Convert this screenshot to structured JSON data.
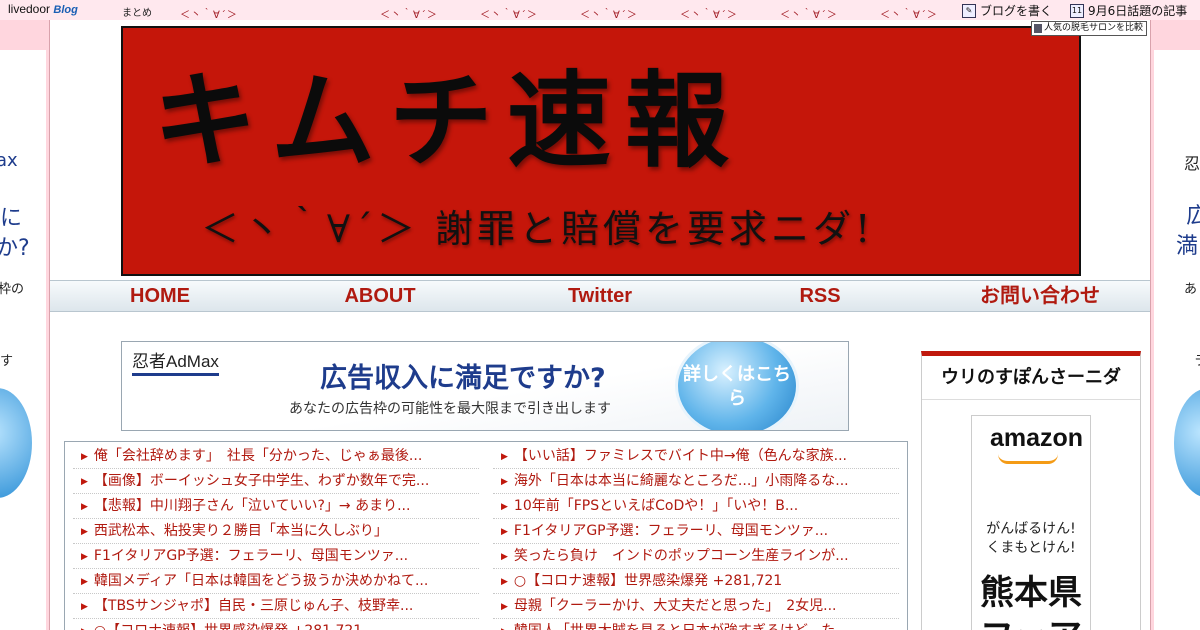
{
  "topbar": {
    "logo_text": "livedoor",
    "logo_blog": "Blog",
    "matome": "まとめ",
    "face": "＜丶｀∀´＞",
    "write_blog": "ブログを書く",
    "topic_article": "9月6日話題の記事",
    "calendar_day": "11"
  },
  "tooltip": "人気の脱毛サロンを比較",
  "side_ad_left": {
    "t1": "ax",
    "t2": "に",
    "t3": "か?",
    "s1": "枠の",
    "s2": "す"
  },
  "side_ad_right": {
    "t0": "忍",
    "t1": "広",
    "t2": "満",
    "s1": "あ",
    "s2": "ラ"
  },
  "header": {
    "title": "キムチ速報",
    "subtitle": "＜丶｀∀´＞ 謝罪と賠償を要求ニダ!"
  },
  "nav": {
    "items": [
      "HOME",
      "ABOUT",
      "Twitter",
      "RSS",
      "お問い合わせ"
    ]
  },
  "ad": {
    "brand": "忍者AdMax",
    "headline": "広告収入に満足ですか?",
    "sub": "あなたの広告枠の可能性を最大限まで引き出します",
    "button": "詳しくはこちら"
  },
  "headlines": {
    "left": [
      "俺「会社辞めます」　社長「分かった、じゃぁ最後...",
      "【画像】ボーイッシュ女子中学生、わずか数年で完...",
      "【悲報】中川翔子さん「泣いていい?」→ あまり...",
      "西武松本、粘投実り２勝目「本当に久しぶり」",
      "F1イタリアGP予選：フェラーリ、母国モンツァ...",
      "韓国メディア「日本は韓国をどう扱うか決めかねて...",
      "【TBSサンジャポ】自民・三原じゅん子、枝野幸...",
      "○【コロナ速報】世界感染爆発 +281,721"
    ],
    "right": [
      "【いい話】ファミレスでバイト中→俺（色んな家族...",
      "海外「日本は本当に綺麗なところだ...」小雨降るな...",
      "10年前「FPSといえばCoDや！」「いや！B...",
      "F1イタリアGP予選：フェラーリ、母国モンツァ...",
      "笑ったら負け　インドのポップコーン生産ラインが...",
      "○【コロナ速報】世界感染爆発 +281,721",
      "母親「クーラーかけ、大丈夫だと思った」　2女児...",
      "韓国人「世界大賊を見ると日本が強すぎるけど...た..."
    ]
  },
  "sidebar": {
    "title": "ウリのすぽんさーニダ",
    "amazon_logo": "amazon",
    "slogan_1": "がんばるけん!",
    "slogan_2": "くまもとけん!",
    "big_text": "熊本県フェア"
  },
  "colors": {
    "banner_red": "#c5160a",
    "link_red": "#b01a10",
    "page_bg": "#ffd6de",
    "admax_blue": "#1e3c8c"
  }
}
